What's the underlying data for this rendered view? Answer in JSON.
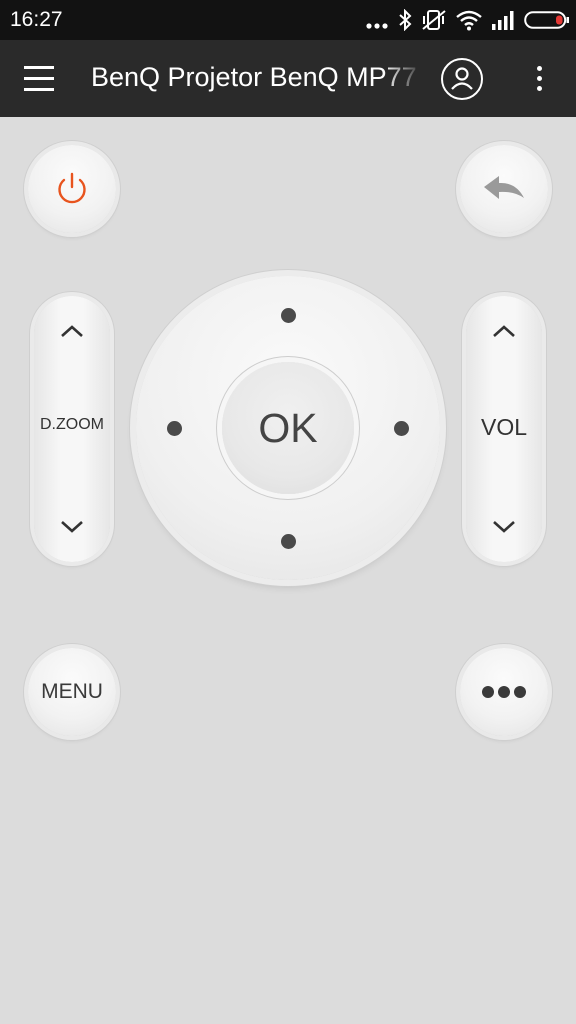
{
  "status_bar": {
    "time": "16:27",
    "icons": [
      "more-dots-icon",
      "bluetooth-icon",
      "vibrate-off-icon",
      "wifi-icon",
      "signal-icon",
      "battery-low-icon"
    ]
  },
  "app_bar": {
    "title": "BenQ Projetor BenQ MP77",
    "icons": [
      "hamburger-menu-icon",
      "account-circle-icon",
      "overflow-menu-icon"
    ]
  },
  "remote": {
    "power_icon": "power-icon",
    "back_icon": "back-arrow-icon",
    "zoom_label": "D.ZOOM",
    "volume_label": "VOL",
    "ok_label": "OK",
    "menu_label": "MENU",
    "more_icon": "more-horizontal-icon"
  },
  "colors": {
    "background": "#dcdcdc",
    "app_bar": "#2a2a2a",
    "status_bar": "#121212",
    "power_accent": "#e8541e",
    "battery_accent": "#e53935"
  }
}
